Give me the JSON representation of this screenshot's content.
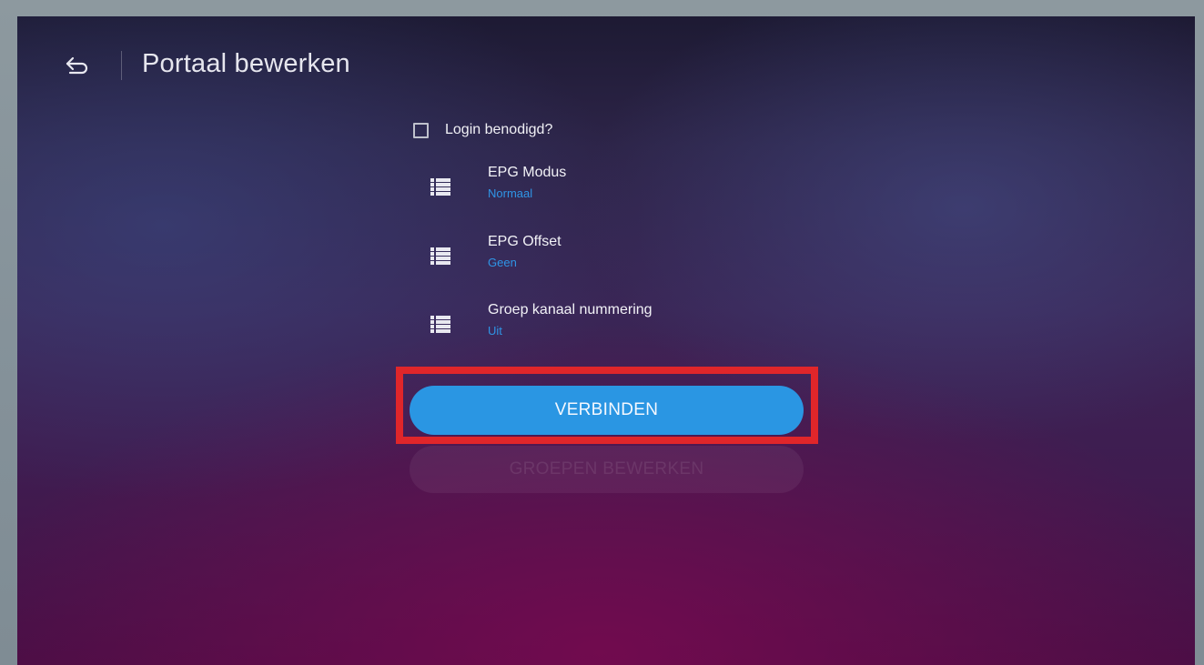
{
  "header": {
    "title": "Portaal bewerken",
    "back_icon": "back-arrow-icon"
  },
  "login": {
    "label": "Login benodigd?",
    "checked": false
  },
  "settings": [
    {
      "title": "EPG Modus",
      "value": "Normaal",
      "icon": "list-icon"
    },
    {
      "title": "EPG Offset",
      "value": "Geen",
      "icon": "list-icon"
    },
    {
      "title": "Groep kanaal nummering",
      "value": "Uit",
      "icon": "list-icon"
    }
  ],
  "buttons": {
    "connect_label": "VERBINDEN",
    "edit_groups_label": "GROEPEN BEWERKEN"
  },
  "colors": {
    "accent": "#2a96e3",
    "highlight": "#e0262a",
    "value_text": "#2f95e6"
  }
}
